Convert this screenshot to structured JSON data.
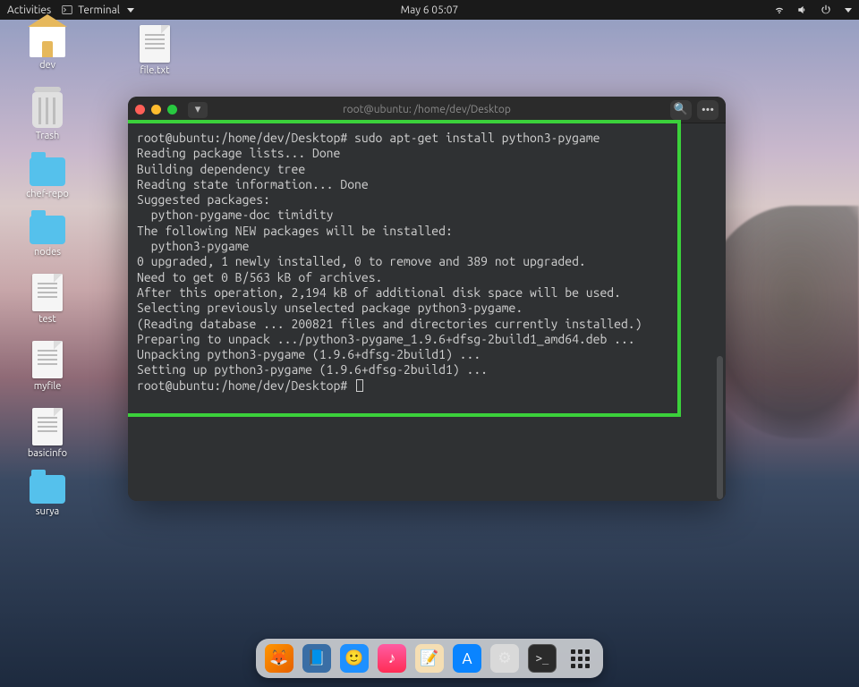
{
  "topbar": {
    "activities": "Activities",
    "app_label": "Terminal",
    "datetime": "May 6  05:07"
  },
  "desktop_icons": {
    "dev": "dev",
    "file_txt": "file.txt",
    "trash": "Trash",
    "chef_repo": "chef-repo",
    "nodes": "nodes",
    "test": "test",
    "myfile": "myfile",
    "basicinfo": "basicinfo",
    "surya": "surya"
  },
  "terminal": {
    "title": "root@ubuntu: /home/dev/Desktop",
    "search_btn": "🔍",
    "menu_btn": "•••",
    "newtab": "▾",
    "lines": {
      "l0": "root@ubuntu:/home/dev/Desktop# sudo apt-get install python3-pygame",
      "l1": "Reading package lists... Done",
      "l2": "Building dependency tree",
      "l3": "Reading state information... Done",
      "l4": "Suggested packages:",
      "l5": "  python-pygame-doc timidity",
      "l6": "The following NEW packages will be installed:",
      "l7": "  python3-pygame",
      "l8": "0 upgraded, 1 newly installed, 0 to remove and 389 not upgraded.",
      "l9": "Need to get 0 B/563 kB of archives.",
      "l10": "After this operation, 2,194 kB of additional disk space will be used.",
      "l11": "Selecting previously unselected package python3-pygame.",
      "l12": "(Reading database ... 200821 files and directories currently installed.)",
      "l13": "Preparing to unpack .../python3-pygame_1.9.6+dfsg-2build1_amd64.deb ...",
      "l14": "Unpacking python3-pygame (1.9.6+dfsg-2build1) ...",
      "l15": "Setting up python3-pygame (1.9.6+dfsg-2build1) ...",
      "l16": "root@ubuntu:/home/dev/Desktop# "
    }
  },
  "dock": {
    "firefox": "🦊",
    "files": "📘",
    "finder": "🙂",
    "music": "♪",
    "notes": "📝",
    "store": "A",
    "settings": "⚙",
    "terminal": ">_"
  }
}
